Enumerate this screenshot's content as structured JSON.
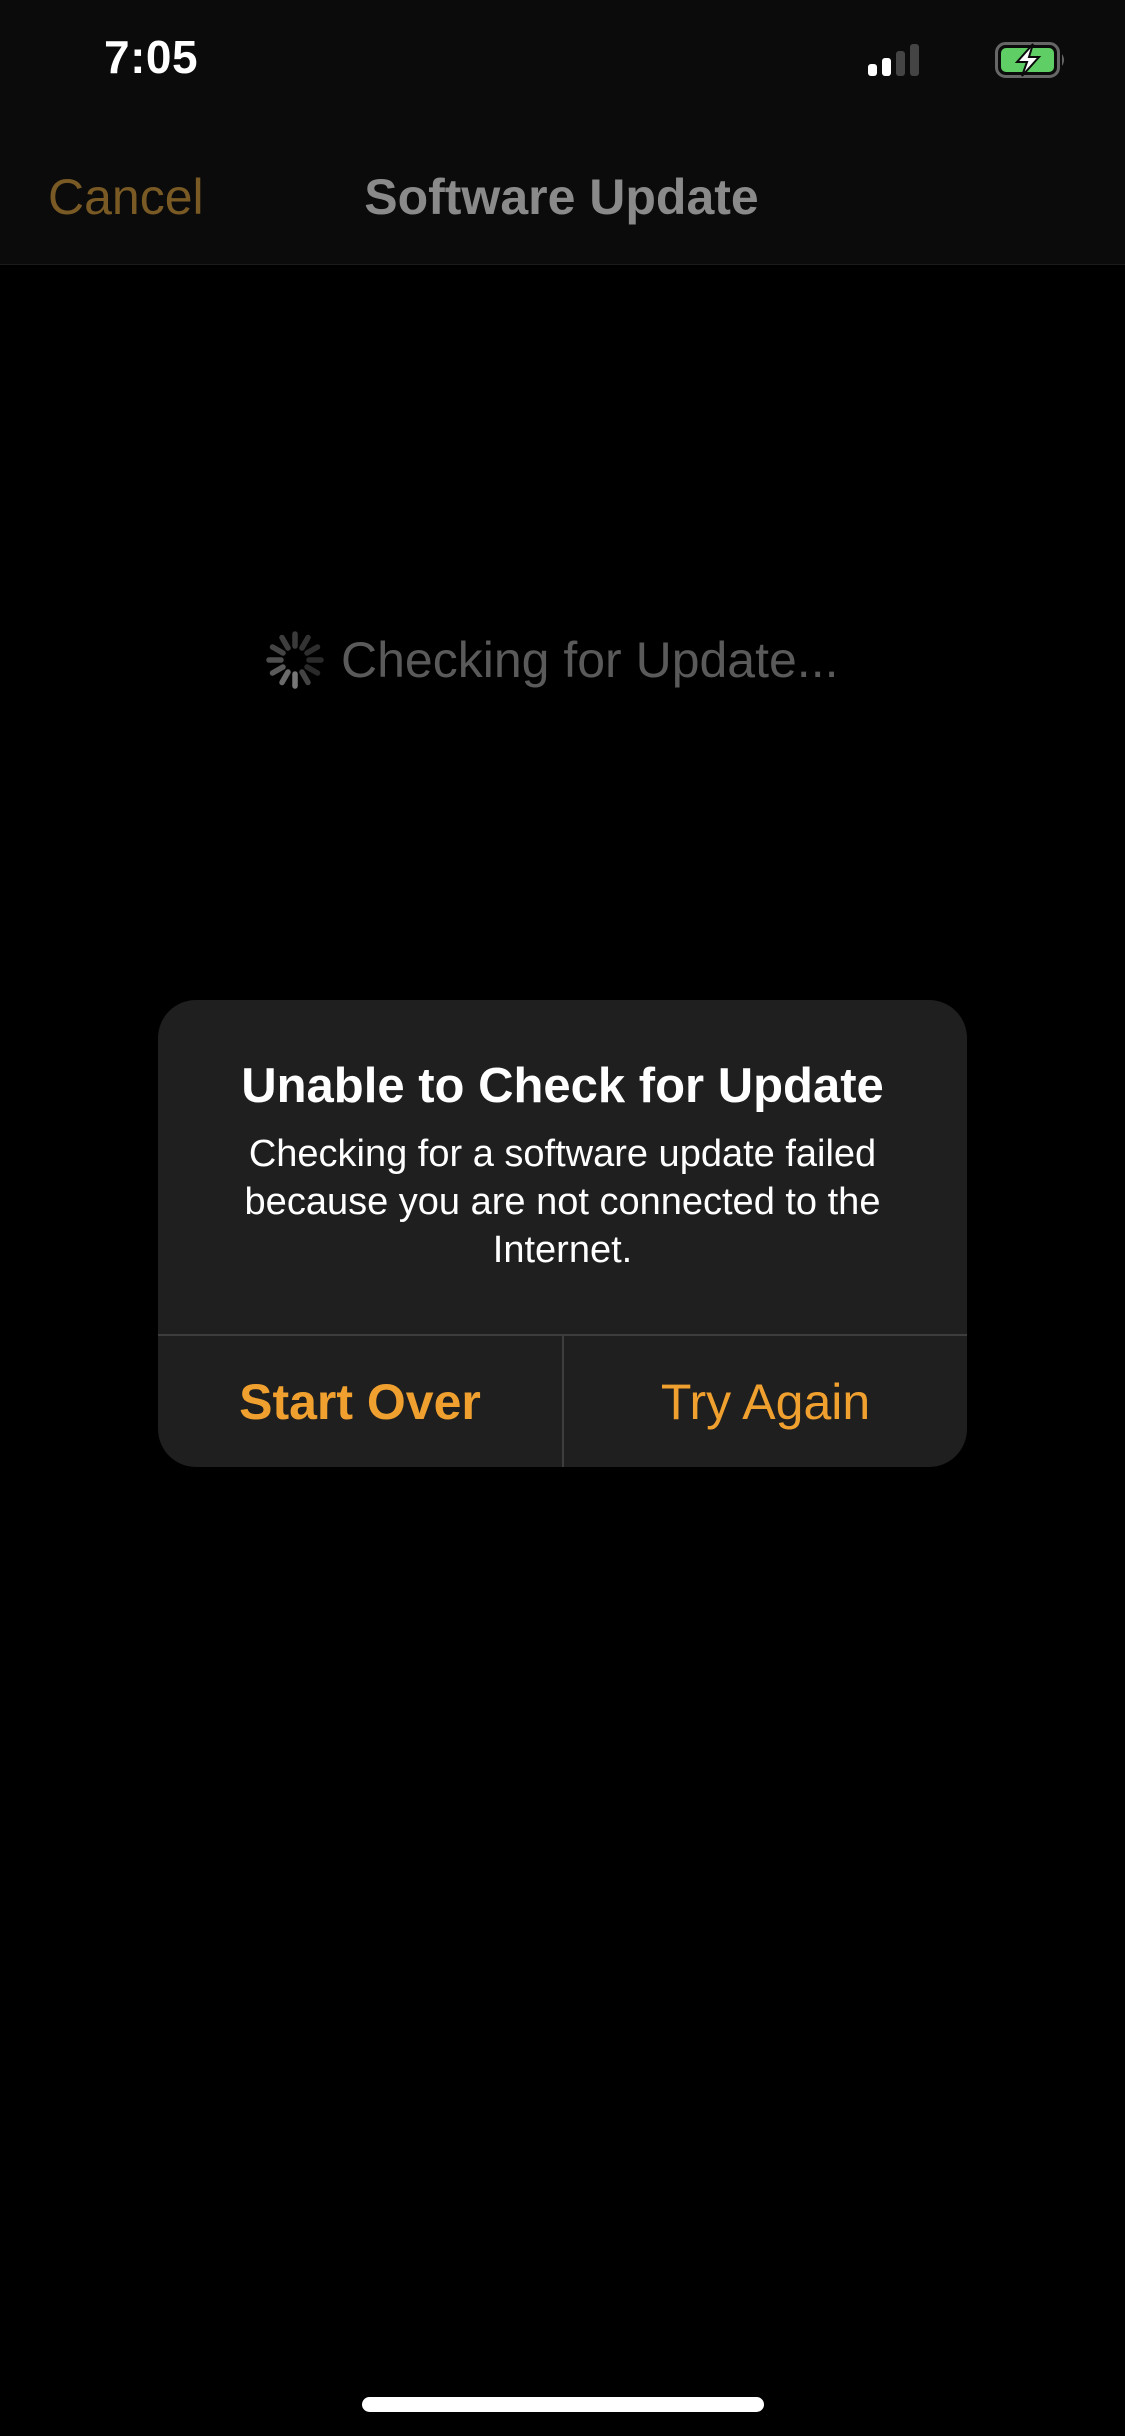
{
  "status_bar": {
    "time": "7:05",
    "signal_icon": "cellular-signal-icon",
    "signal_bars_active": 2,
    "signal_bars_total": 4,
    "battery_icon": "battery-charging-icon",
    "battery_color": "#5fcf65"
  },
  "nav_bar": {
    "cancel_label": "Cancel",
    "title": "Software Update",
    "accent_color": "#7a5a24"
  },
  "main": {
    "spinner_icon": "activity-spinner-icon",
    "status_text": "Checking for Update..."
  },
  "alert": {
    "title": "Unable to Check for Update",
    "message": "Checking for a software update failed because you are not connected to the Internet.",
    "buttons": [
      {
        "label": "Start Over"
      },
      {
        "label": "Try Again"
      }
    ],
    "button_color": "#f0a02e"
  }
}
